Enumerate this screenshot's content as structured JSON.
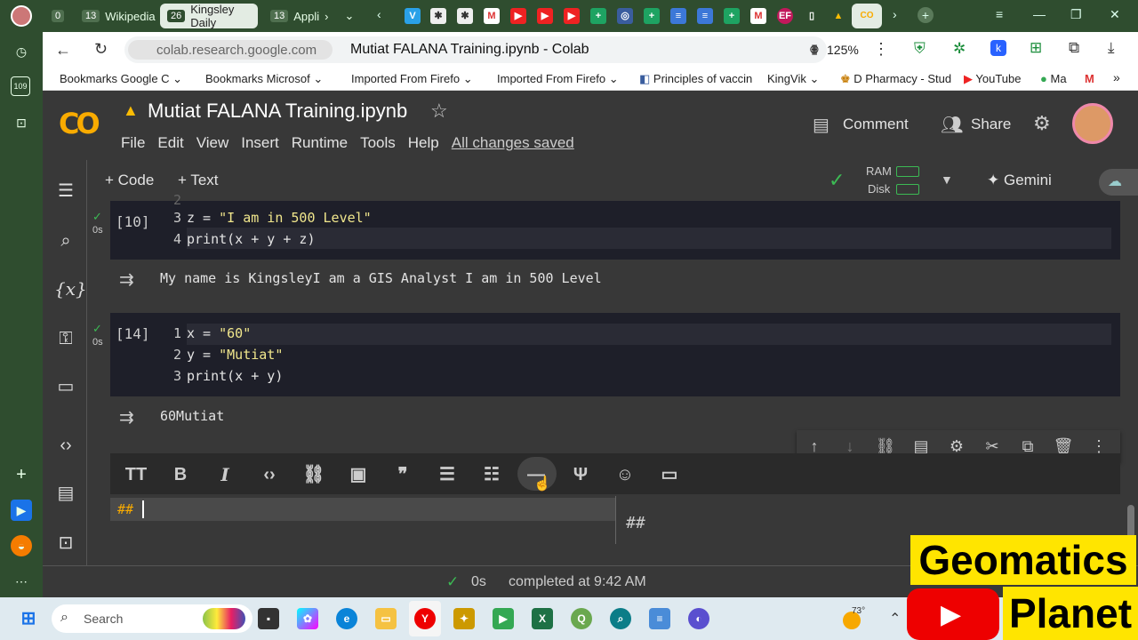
{
  "browser": {
    "tabs": [
      {
        "count": "0",
        "label": ""
      },
      {
        "count": "13",
        "label": "Wikipedia"
      },
      {
        "count": "26",
        "label": "Kingsley Daily"
      },
      {
        "count": "13",
        "label": "Appli"
      }
    ],
    "url": "colab.research.google.com",
    "page_title": "Mutiat FALANA Training.ipynb - Colab",
    "zoom": "125%",
    "bookmarks": [
      "Bookmarks Google C",
      "Bookmarks Microsof",
      "Imported From Firefo",
      "Imported From Firefo",
      "Principles of vaccin",
      "KingVik",
      "D Pharmacy - Stud",
      "YouTube",
      "Ma"
    ],
    "sidebar_counter": "109"
  },
  "colab": {
    "logo": "CO",
    "notebook_title": "Mutiat FALANA Training.ipynb",
    "menu": [
      "File",
      "Edit",
      "View",
      "Insert",
      "Runtime",
      "Tools",
      "Help"
    ],
    "save_status": "All changes saved",
    "comment_label": "Comment",
    "share_label": "Share",
    "add_code": "+ Code",
    "add_text": "+ Text",
    "ram_label": "RAM",
    "disk_label": "Disk",
    "gemini_label": "Gemini"
  },
  "cells": [
    {
      "exec_count": "[10]",
      "time": "0s",
      "lines": [
        {
          "num": "3",
          "var": "z",
          "value": "\"I am in 500 Level\""
        },
        {
          "num": "4",
          "code": "print(x + y + z)"
        }
      ],
      "output": "My name is KingsleyI am a GIS Analyst I am in 500 Level"
    },
    {
      "exec_count": "[14]",
      "time": "0s",
      "lines": [
        {
          "num": "1",
          "var": "x",
          "value": "\"60\""
        },
        {
          "num": "2",
          "var": "y",
          "value": "\"Mutiat\""
        },
        {
          "num": "3",
          "code": "print(x + y)"
        }
      ],
      "output": "60Mutiat"
    }
  ],
  "text_cell": {
    "editor_value": "##",
    "preview": "##"
  },
  "status": {
    "time": "0s",
    "completed": "completed at 9:42 AM"
  },
  "taskbar": {
    "search_label": "Search",
    "weather": "73°"
  },
  "watermark": {
    "line1": "Geomatics",
    "line2": "Planet"
  },
  "colors": {
    "browser_frame": "#2f4d2f",
    "colab_bg": "#383838",
    "code_bg": "#1e1f29",
    "string": "#f0e68c",
    "check": "#3cba54",
    "logo_orange": "#f9ab00",
    "watermark": "#ffe500"
  }
}
